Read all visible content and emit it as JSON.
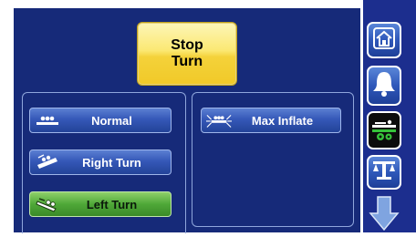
{
  "top": {
    "stop_turn_label": "Stop\nTurn"
  },
  "turn_group": {
    "buttons": [
      {
        "label": "Normal",
        "icon": "bed-flat-icon"
      },
      {
        "label": "Right Turn",
        "icon": "bed-right-turn-icon"
      },
      {
        "label": "Left Turn",
        "icon": "bed-left-turn-icon",
        "active": true
      }
    ]
  },
  "inflate_group": {
    "max_inflate_label": "Max Inflate",
    "icon": "max-inflate-icon"
  },
  "sidebar": {
    "items": [
      {
        "name": "home",
        "icon": "home-icon"
      },
      {
        "name": "alarm",
        "icon": "bell-icon"
      },
      {
        "name": "therapy-settings",
        "icon": "bed-settings-icon",
        "selected": true
      },
      {
        "name": "scale",
        "icon": "scale-icon"
      }
    ],
    "scroll_icon": "arrow-down-icon"
  },
  "colors": {
    "panel_bg": "#162a79",
    "stop_button": "#f4d23a",
    "active_button": "#4fa838",
    "button_blue": "#3558b8"
  }
}
